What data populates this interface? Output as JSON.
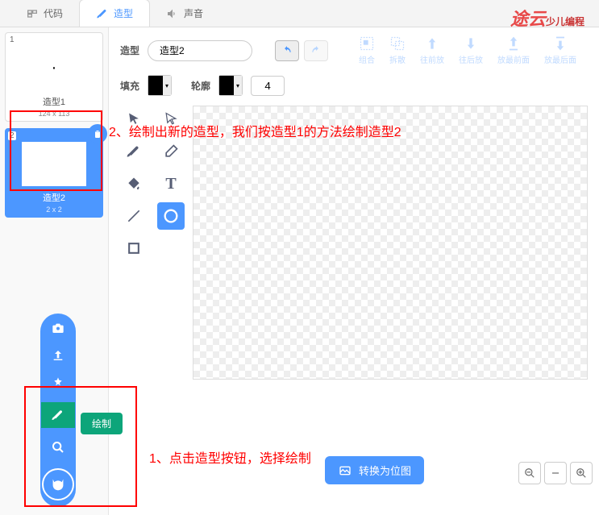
{
  "tabs": {
    "code": "代码",
    "costume": "造型",
    "sound": "声音"
  },
  "logo": {
    "main": "途云",
    "sub": "少儿编程"
  },
  "costumes": [
    {
      "num": "1",
      "name": "造型1",
      "dim": "124 x 113"
    },
    {
      "num": "2",
      "name": "造型2",
      "dim": "2 x 2"
    }
  ],
  "editor": {
    "name_label": "造型",
    "name_value": "造型2",
    "fill_label": "填充",
    "stroke_label": "轮廓",
    "stroke_width": "4",
    "actions": {
      "group": "组合",
      "ungroup": "拆散",
      "forward": "往前放",
      "backward": "往后放",
      "front": "放最前面",
      "back": "放最后面"
    }
  },
  "annotations": {
    "a1": "2、绘制出新的造型，我们按造型1的方法绘制造型2",
    "a2": "1、点击造型按钮，选择绘制"
  },
  "tooltip": "绘制",
  "convert": "转换为位图"
}
